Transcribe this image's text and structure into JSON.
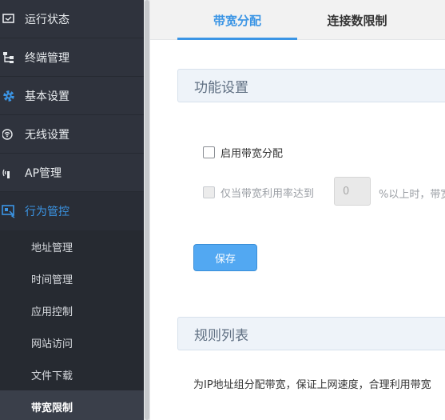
{
  "sidebar": {
    "items": [
      {
        "label": "运行状态",
        "icon": "monitor-icon"
      },
      {
        "label": "终端管理",
        "icon": "network-tree-icon"
      },
      {
        "label": "基本设置",
        "icon": "gear-icon"
      },
      {
        "label": "无线设置",
        "icon": "wifi-icon"
      },
      {
        "label": "AP管理",
        "icon": "access-point-icon"
      },
      {
        "label": "行为管控",
        "icon": "behavior-control-icon"
      }
    ],
    "sub_items": [
      {
        "label": "地址管理"
      },
      {
        "label": "时间管理"
      },
      {
        "label": "应用控制"
      },
      {
        "label": "网站访问"
      },
      {
        "label": "文件下载"
      },
      {
        "label": "带宽限制"
      }
    ],
    "colors": {
      "accent": "#3b95e5",
      "background": "#2f333d"
    }
  },
  "tabs": [
    {
      "label": "带宽分配",
      "active": true
    },
    {
      "label": "连接数限制",
      "active": false
    }
  ],
  "feature_section": {
    "title": "功能设置",
    "enable_label": "启用带宽分配",
    "threshold_label": "仅当带宽利用率达到",
    "threshold_value": "0",
    "threshold_suffix": "%以上时，带宽",
    "save_label": "保存"
  },
  "rules_section": {
    "title": "规则列表",
    "description": "为IP地址组分配带宽，保证上网速度，合理利用带宽"
  }
}
